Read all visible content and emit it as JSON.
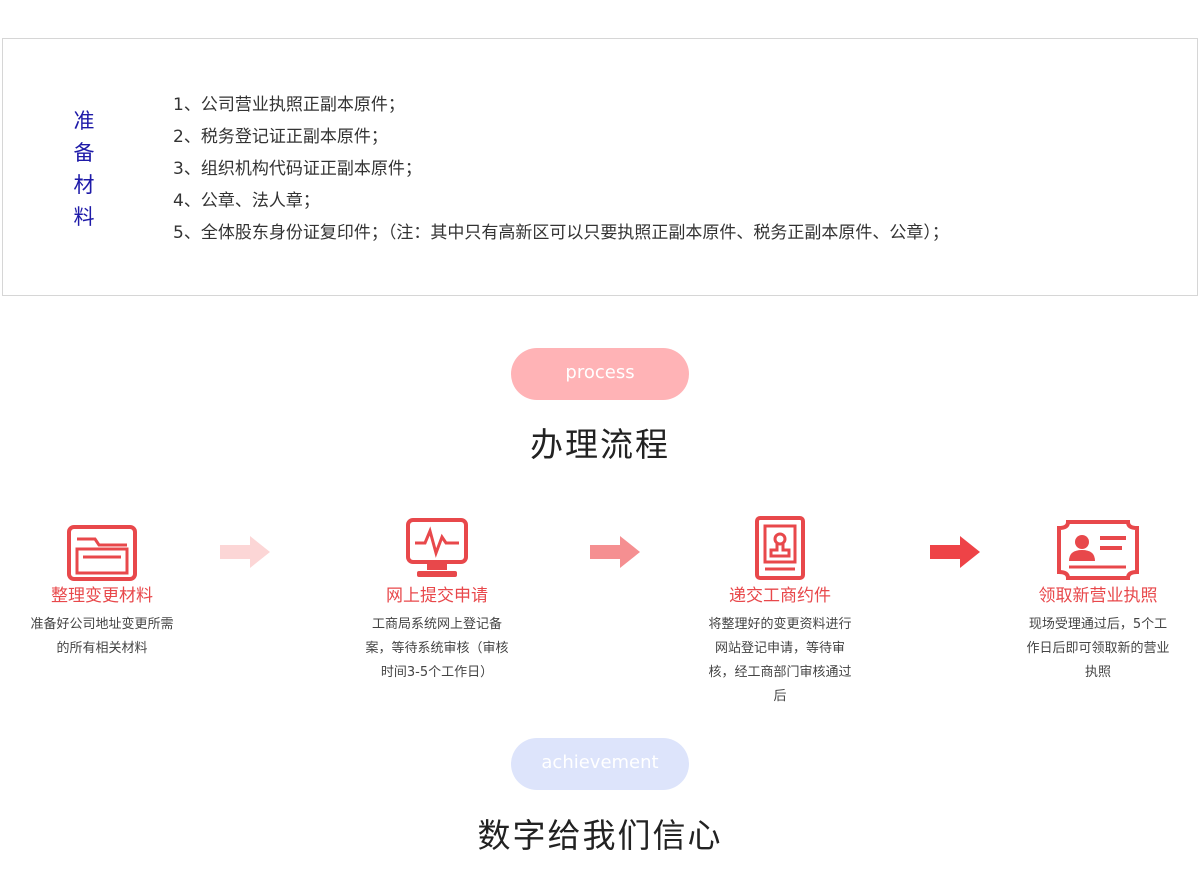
{
  "materials": {
    "label_chars": [
      "准",
      "备",
      "材",
      "料"
    ],
    "items": [
      "1、公司营业执照正副本原件；",
      "2、税务登记证正副本原件；",
      "3、组织机构代码证正副本原件；",
      "4、公章、法人章；",
      "5、全体股东身份证复印件；（注：其中只有高新区可以只要执照正副本原件、税务正副本原件、公章）；"
    ]
  },
  "process": {
    "pill_label": "process",
    "title": "办理流程",
    "accent_color": "#e8484b",
    "steps": [
      {
        "title": "整理变更材料",
        "desc": "准备好公司地址变更所需的所有相关材料",
        "icon": "folder-icon"
      },
      {
        "title": "网上提交申请",
        "desc": "工商局系统网上登记备案，等待系统审核（审核时间3-5个工作日）",
        "icon": "monitor-icon"
      },
      {
        "title": "递交工商约件",
        "desc": "将整理好的变更资料进行网站登记申请，等待审核，经工商部门审核通过后",
        "icon": "stamp-document-icon"
      },
      {
        "title": "领取新营业执照",
        "desc": "现场受理通过后，5个工作日后即可领取新的营业执照",
        "icon": "id-card-icon"
      }
    ]
  },
  "achievement": {
    "pill_label": "achievement",
    "title": "数字给我们信心"
  }
}
